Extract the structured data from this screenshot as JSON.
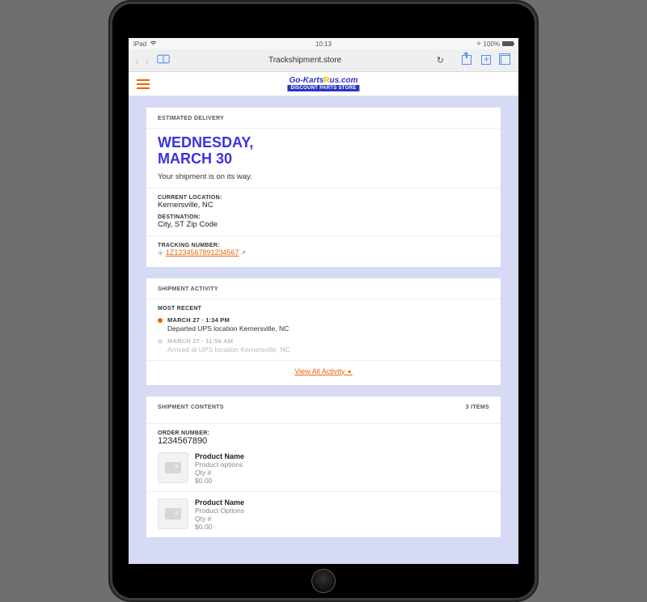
{
  "status_bar": {
    "carrier": "iPad",
    "time": "10:13",
    "battery": "100%"
  },
  "browser": {
    "url": "Trackshipment.store"
  },
  "logo": {
    "line1_a": "Go-Karts",
    "line1_b": "R",
    "line1_c": "us.com",
    "line2": "DISCOUNT PARTS STORE"
  },
  "delivery": {
    "section_label": "ESTIMATED DELIVERY",
    "date_line1": "WEDNESDAY,",
    "date_line2": "MARCH 30",
    "status": "Your shipment is on its way.",
    "current_label": "CURRENT LOCATION:",
    "current_value": "Kernersville, NC",
    "dest_label": "DESTINATION:",
    "dest_value": "City, ST Zip Code",
    "tracking_label": "TRACKING NUMBER:",
    "tracking_value": "1Z1234567891234567"
  },
  "activity": {
    "section_label": "SHIPMENT ACTIVITY",
    "recent_label": "MOST RECENT",
    "items": [
      {
        "time": "MARCH 27 · 1:34 PM",
        "desc": "Departed UPS location Kernersville, NC",
        "active": true
      },
      {
        "time": "MARCH 27 · 11:56 AM",
        "desc": "Arrived at UPS location Kernersville, NC",
        "active": false
      }
    ],
    "view_all": "View All Activity"
  },
  "contents": {
    "section_label": "SHIPMENT CONTENTS",
    "count_label": "3 ITEMS",
    "order_label": "ORDER NUMBER:",
    "order_value": "1234567890",
    "products": [
      {
        "name": "Product Name",
        "options": "Product options",
        "qty": "Qty #",
        "price": "$0.00"
      },
      {
        "name": "Product Name",
        "options": "Product Options",
        "qty": "Qty #",
        "price": "$0.00"
      }
    ]
  }
}
